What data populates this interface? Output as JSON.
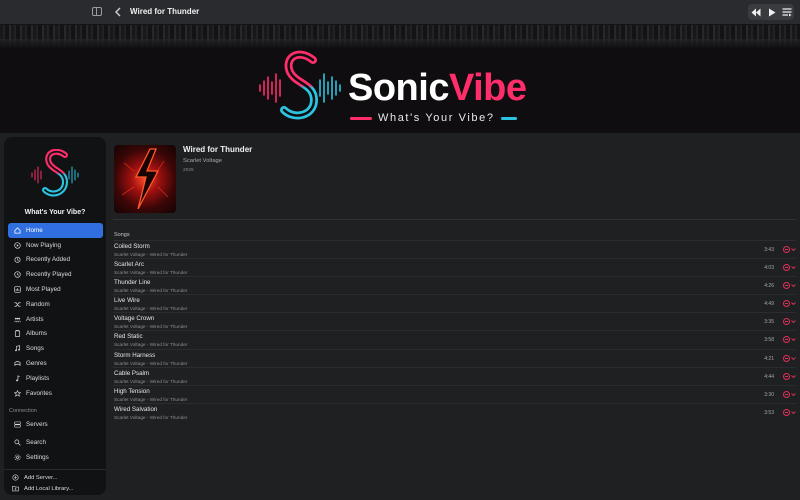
{
  "window": {
    "title": "Wired for Thunder"
  },
  "toolbar": {
    "controls": [
      "rewind-icon",
      "play-icon",
      "queue-icon"
    ]
  },
  "banner": {
    "brand_part1": "Sonic",
    "brand_part2": "Vibe",
    "tagline": "What's Your Vibe?",
    "colors": {
      "pink": "#ff2d6a",
      "cyan": "#2bc4e0"
    }
  },
  "sidebar": {
    "tagline": "What's Your Vibe?",
    "items": [
      {
        "label": "Home",
        "icon": "home-icon",
        "active": true
      },
      {
        "label": "Now Playing",
        "icon": "now-playing-icon"
      },
      {
        "label": "Recently Added",
        "icon": "recently-added-icon"
      },
      {
        "label": "Recently Played",
        "icon": "recently-played-icon"
      },
      {
        "label": "Most Played",
        "icon": "most-played-icon"
      },
      {
        "label": "Random",
        "icon": "shuffle-icon"
      },
      {
        "label": "Artists",
        "icon": "artists-icon"
      },
      {
        "label": "Albums",
        "icon": "albums-icon"
      },
      {
        "label": "Songs",
        "icon": "songs-icon"
      },
      {
        "label": "Genres",
        "icon": "genres-icon"
      },
      {
        "label": "Playlists",
        "icon": "playlists-icon"
      },
      {
        "label": "Favorites",
        "icon": "star-icon"
      }
    ],
    "section_connection": "Connection",
    "servers_label": "Servers",
    "search_label": "Search",
    "settings_label": "Settings",
    "add_server_label": "Add Server...",
    "add_local_label": "Add Local Library..."
  },
  "album": {
    "title": "Wired for Thunder",
    "artist": "Scarlet Voltage",
    "year": "2025",
    "songs_label": "Songs",
    "tracks": [
      {
        "title": "Coiled Storm",
        "subtitle": "Scarlet Voltage - Wired for Thunder",
        "duration": "3:43"
      },
      {
        "title": "Scarlet Arc",
        "subtitle": "Scarlet Voltage - Wired for Thunder",
        "duration": "4:03"
      },
      {
        "title": "Thunder Line",
        "subtitle": "Scarlet Voltage - Wired for Thunder",
        "duration": "4:26"
      },
      {
        "title": "Live Wire",
        "subtitle": "Scarlet Voltage - Wired for Thunder",
        "duration": "4:49"
      },
      {
        "title": "Voltage Crown",
        "subtitle": "Scarlet Voltage - Wired for Thunder",
        "duration": "3:35"
      },
      {
        "title": "Red Static",
        "subtitle": "Scarlet Voltage - Wired for Thunder",
        "duration": "3:58"
      },
      {
        "title": "Storm Harness",
        "subtitle": "Scarlet Voltage - Wired for Thunder",
        "duration": "4:21"
      },
      {
        "title": "Cable Psalm",
        "subtitle": "Scarlet Voltage - Wired for Thunder",
        "duration": "4:44"
      },
      {
        "title": "High Tension",
        "subtitle": "Scarlet Voltage - Wired for Thunder",
        "duration": "3:30"
      },
      {
        "title": "Wired Salvation",
        "subtitle": "Scarlet Voltage - Wired for Thunder",
        "duration": "3:53"
      }
    ]
  },
  "accent": "#2f6fe0"
}
